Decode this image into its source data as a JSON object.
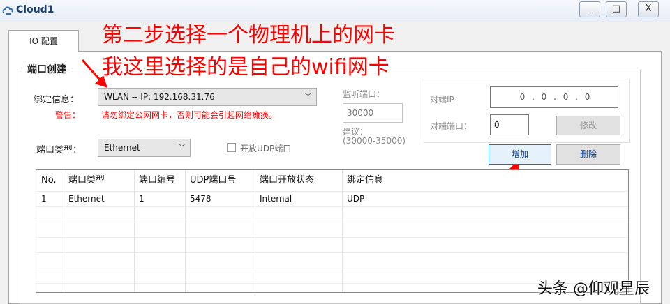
{
  "window": {
    "title": "Cloud1",
    "minimize": "_",
    "maximize": "□",
    "close": "X"
  },
  "tabs": [
    {
      "label": "IO 配置"
    }
  ],
  "annotations": {
    "line1": "第二步选择一个物理机上的网卡",
    "line2": "我这里选择的是自己的wifi网卡",
    "arrow_color": "#ff0000"
  },
  "port_create": {
    "title": "端口创建",
    "binding_label": "绑定信息：",
    "binding_value": "WLAN -- IP: 192.168.31.76",
    "warning_label": "警告：",
    "warning_text": "请勿绑定公网网卡，否则可能会引起网络瘫痪。",
    "port_type_label": "端口类型：",
    "port_type_value": "Ethernet",
    "udp_checkbox_label": "开放UDP端口",
    "listen_port_label": "监听端口：",
    "listen_port_value": "30000",
    "suggest_label": "建议：",
    "suggest_range": "(30000-35000)",
    "peer_ip_label": "对端IP：",
    "peer_ip_value": "0 . 0 . 0 . 0",
    "peer_port_label": "对端端口：",
    "peer_port_value": "0",
    "modify_button": "修改",
    "add_button": "增加",
    "delete_button": "删除"
  },
  "table": {
    "columns": [
      "No.",
      "端口类型",
      "端口编号",
      "UDP端口号",
      "端口开放状态",
      "绑定信息"
    ],
    "rows": [
      [
        "1",
        "Ethernet",
        "1",
        "5478",
        "Internal",
        "UDP"
      ]
    ]
  },
  "watermark": "头条 @仰观星辰"
}
